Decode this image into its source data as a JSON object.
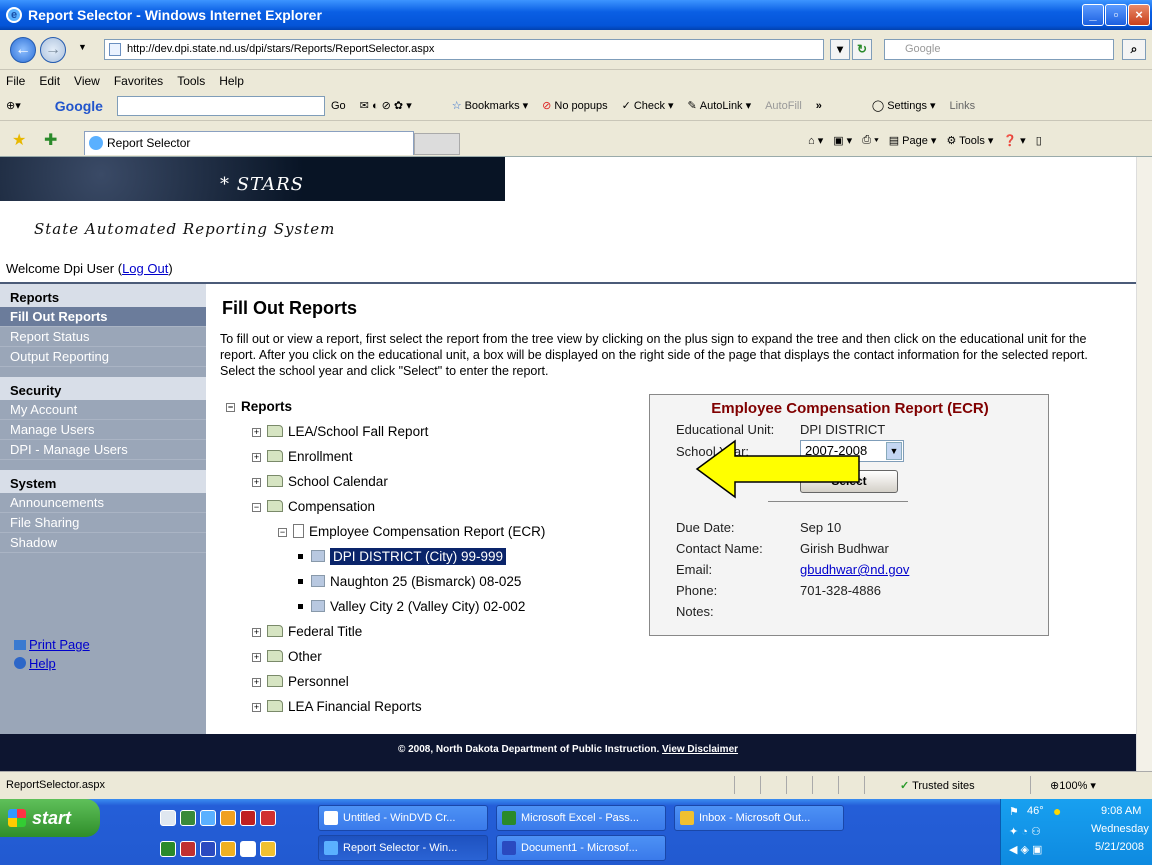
{
  "window": {
    "title": "Report Selector - Windows Internet Explorer"
  },
  "address": {
    "url": "http://dev.dpi.state.nd.us/dpi/stars/Reports/ReportSelector.aspx",
    "search_placeholder": "Google"
  },
  "menu": [
    "File",
    "Edit",
    "View",
    "Favorites",
    "Tools",
    "Help"
  ],
  "google_toolbar": {
    "logo": "Google",
    "go": "Go",
    "bookmarks": "Bookmarks",
    "popups": "No popups",
    "check": "Check",
    "autolink": "AutoLink",
    "autofill": "AutoFill",
    "more": "»",
    "settings": "Settings",
    "links": "Links"
  },
  "tabs": {
    "active": "Report Selector"
  },
  "commands": {
    "page": "Page",
    "tools": "Tools"
  },
  "banner": {
    "title": "* STARS",
    "subtitle": "State Automated Reporting System"
  },
  "welcome": {
    "text": "Welcome Dpi User (",
    "logout": "Log Out",
    "close": ")"
  },
  "sidebar": {
    "reports_header": "Reports",
    "reports_items": [
      "Fill Out Reports",
      "Report Status",
      "Output Reporting"
    ],
    "security_header": "Security",
    "security_items": [
      "My Account",
      "Manage Users",
      "DPI - Manage Users"
    ],
    "system_header": "System",
    "system_items": [
      "Announcements",
      "File Sharing",
      "Shadow"
    ],
    "print": "Print Page",
    "help": "Help"
  },
  "main": {
    "title": "Fill Out Reports",
    "intro": "To fill out or view a report, first select the report from the tree view by clicking on the plus sign to expand the tree and then click on the educational unit for the report. After you click on the educational unit, a box will be displayed on the right side of the page that displays the contact information for the selected report. Select the school year and click \"Select\" to enter the report."
  },
  "tree": {
    "root": "Reports",
    "nodes": [
      "LEA/School Fall Report",
      "Enrollment",
      "School Calendar",
      "Compensation"
    ],
    "report": "Employee Compensation Report (ECR)",
    "units": [
      "DPI DISTRICT (City) 99-999",
      "Naughton 25 (Bismarck) 08-025",
      "Valley City 2 (Valley City) 02-002"
    ],
    "after": [
      "Federal Title",
      "Other",
      "Personnel",
      "LEA Financial Reports"
    ]
  },
  "ecr": {
    "title": "Employee Compensation Report (ECR)",
    "unit_label": "Educational Unit:",
    "unit_value": "DPI DISTRICT",
    "year_label": "School Year:",
    "year_value": "2007-2008",
    "select": "Select",
    "due_label": "Due Date:",
    "due_value": "Sep 10",
    "contact_label": "Contact Name:",
    "contact_value": "Girish Budhwar",
    "email_label": "Email:",
    "email_value": "gbudhwar@nd.gov",
    "phone_label": "Phone:",
    "phone_value": "701-328-4886",
    "notes_label": "Notes:"
  },
  "footer": {
    "text": "© 2008, North Dakota Department of Public Instruction. ",
    "link": "View Disclaimer"
  },
  "status": {
    "text": "ReportSelector.aspx",
    "zone": "Trusted sites",
    "zoom": "100%"
  },
  "taskbar": {
    "start": "start",
    "tasks": [
      "Untitled - WinDVD Cr...",
      "Microsoft Excel - Pass...",
      "Inbox - Microsoft Out...",
      "Report Selector - Win...",
      "Document1 - Microsof..."
    ],
    "temp": "46°",
    "time": "9:08 AM",
    "day": "Wednesday",
    "date": "5/21/2008"
  },
  "colors": {
    "selection": "#0a246a",
    "ecr_title": "#800000",
    "arrow": "#ffff00"
  }
}
